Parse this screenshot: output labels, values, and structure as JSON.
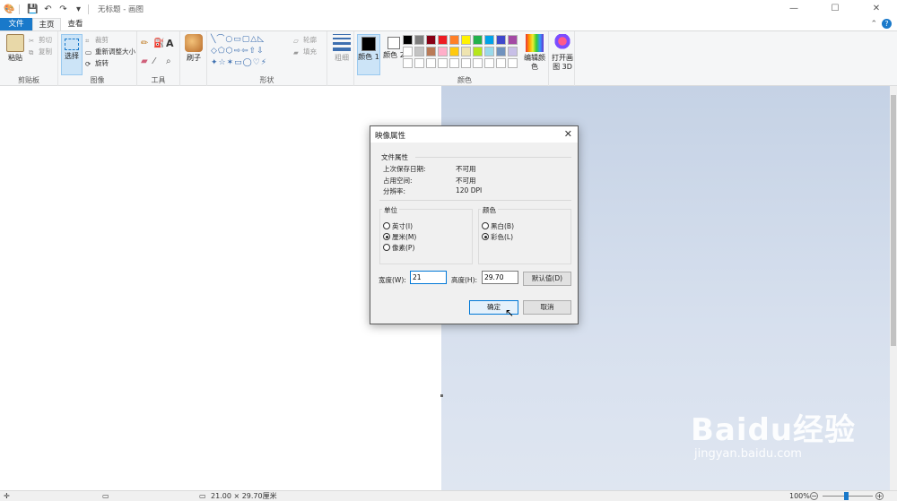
{
  "window": {
    "title": "无标题 - 画图",
    "controls": {
      "minimize": "—",
      "maximize": "☐",
      "close": "✕"
    }
  },
  "tabs": {
    "file": "文件",
    "home": "主页",
    "view": "查看"
  },
  "ribbon": {
    "clipboard": {
      "paste": "粘贴",
      "cut": "剪切",
      "copy": "复制",
      "label": "剪贴板"
    },
    "image": {
      "select": "选择",
      "crop": "裁剪",
      "resize": "重新调整大小",
      "rotate": "旋转",
      "label": "图像"
    },
    "tools": {
      "label": "工具"
    },
    "brushes": {
      "label": "刷子"
    },
    "shapes": {
      "outline": "轮廓",
      "fill": "填充",
      "label": "形状"
    },
    "size": {
      "label": "粗细"
    },
    "color1": "颜色 1",
    "color2": "颜色 2",
    "edit_colors": "编辑颜色",
    "paint3d": "打开画图 3D",
    "colors_label": "颜色",
    "palette": [
      "#000000",
      "#7f7f7f",
      "#880015",
      "#ed1c24",
      "#ff7f27",
      "#fff200",
      "#22b14c",
      "#00a2e8",
      "#3f48cc",
      "#a349a4",
      "#ffffff",
      "#c3c3c3",
      "#b97a57",
      "#ffaec9",
      "#ffc90e",
      "#efe4b0",
      "#b5e61d",
      "#99d9ea",
      "#7092be",
      "#c8bfe7"
    ]
  },
  "status": {
    "size": "21.00 × 29.70厘米",
    "zoom": "100%"
  },
  "dialog": {
    "title": "映像属性",
    "file_props": "文件属性",
    "last_saved_label": "上次保存日期:",
    "last_saved_value": "不可用",
    "disk_size_label": "占用空间:",
    "disk_size_value": "不可用",
    "resolution_label": "分辨率:",
    "resolution_value": "120 DPI",
    "units_label": "单位",
    "unit_inches": "英寸(I)",
    "unit_cm": "厘米(M)",
    "unit_pixels": "像素(P)",
    "color_label": "颜色",
    "color_bw": "黑白(B)",
    "color_color": "彩色(L)",
    "width_label": "宽度(W):",
    "width_value": "21",
    "height_label": "高度(H):",
    "height_value": "29.70",
    "default_button": "默认值(D)",
    "ok_button": "确定",
    "cancel_button": "取消"
  },
  "watermark": {
    "main": "Baidu经验",
    "sub": "jingyan.baidu.com"
  }
}
